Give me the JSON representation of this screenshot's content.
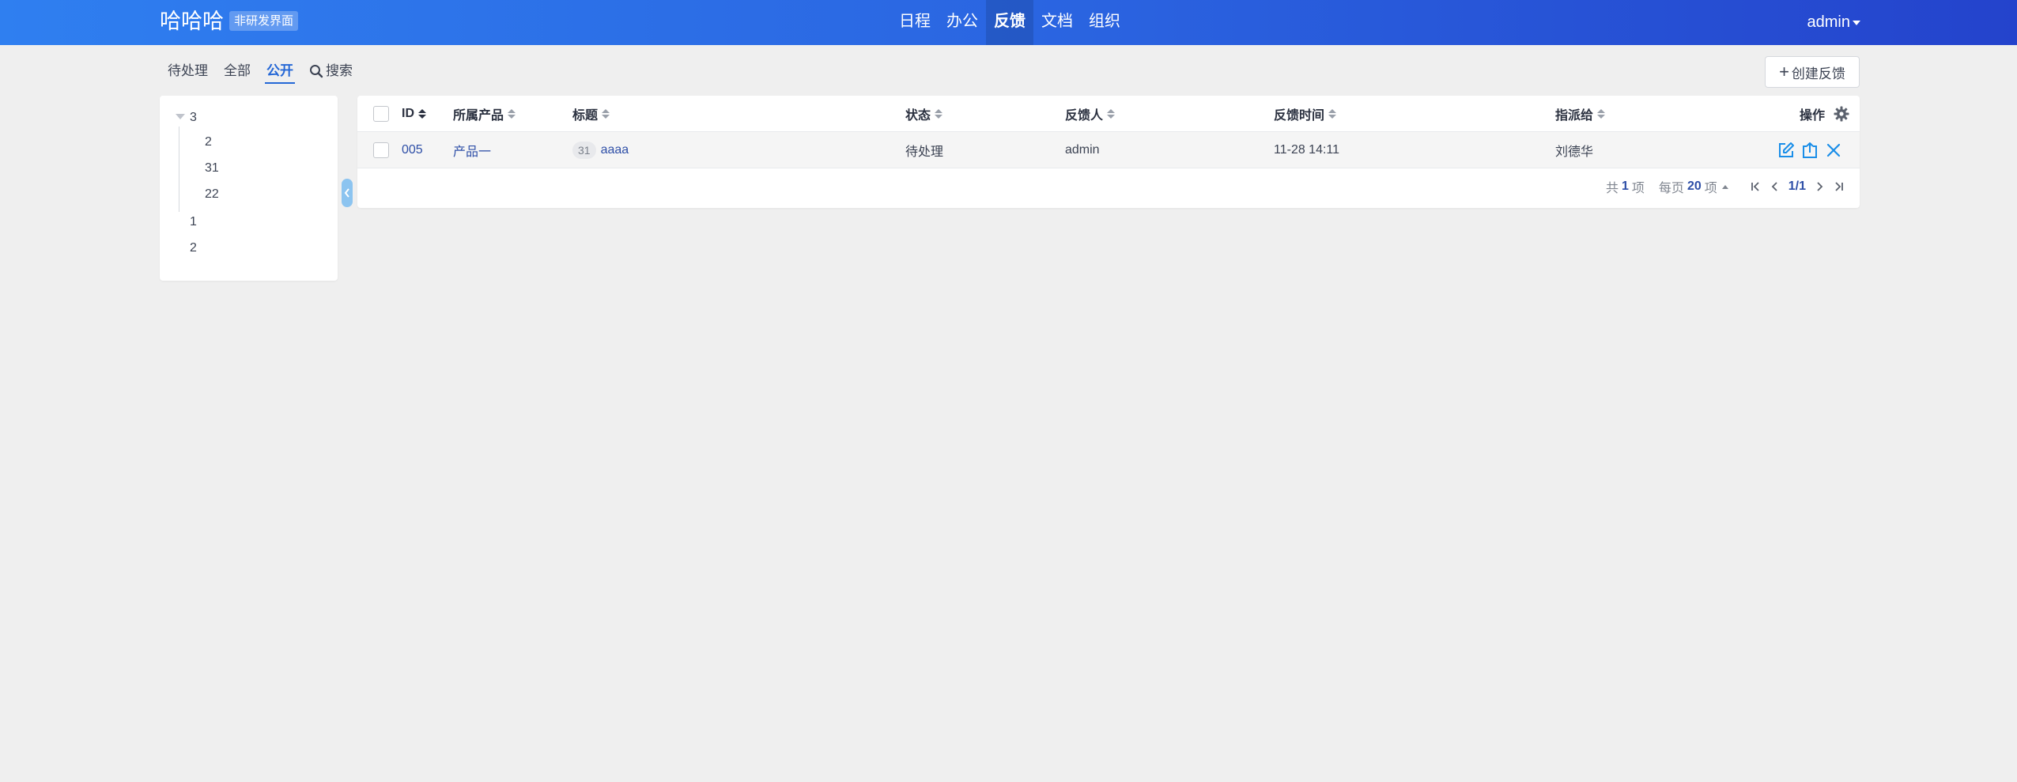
{
  "header": {
    "brand": "哈哈哈",
    "badge": "非研发界面",
    "nav": [
      "日程",
      "办公",
      "反馈",
      "文档",
      "组织"
    ],
    "active_nav": "反馈",
    "user": "admin"
  },
  "subnav": {
    "items": [
      "待处理",
      "全部",
      "公开"
    ],
    "active": "公开",
    "search_label": "搜索",
    "create_label": "创建反馈"
  },
  "tree": {
    "root": "3",
    "children": [
      "2",
      "31",
      "22"
    ],
    "siblings": [
      "1",
      "2"
    ]
  },
  "table": {
    "columns": {
      "id": "ID",
      "product": "所属产品",
      "title": "标题",
      "status": "状态",
      "reporter": "反馈人",
      "time": "反馈时间",
      "assignee": "指派给",
      "actions": "操作"
    },
    "rows": [
      {
        "id": "005",
        "product": "产品一",
        "count": "31",
        "title": "aaaa",
        "status": "待处理",
        "reporter": "admin",
        "time": "11-28 14:11",
        "assignee": "刘德华"
      }
    ]
  },
  "pager": {
    "total_prefix": "共",
    "total": "1",
    "total_suffix": "项",
    "per_page_prefix": "每页",
    "per_page": "20",
    "per_page_suffix": "项",
    "page": "1/1"
  },
  "colors": {
    "header_start": "#2f7ff0",
    "header_end": "#2443cc",
    "accent": "#2467d6",
    "action_icon": "#1a8ee8",
    "link": "#2e4fa7"
  }
}
